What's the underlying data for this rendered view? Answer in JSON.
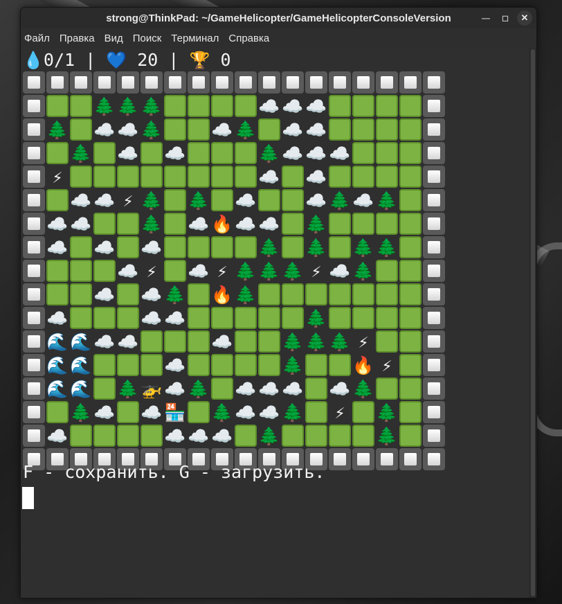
{
  "window": {
    "title": "strong@ThinkPad: ~/GameHelicopter/GameHelicopterConsoleVersion"
  },
  "menu": [
    "Файл",
    "Правка",
    "Вид",
    "Поиск",
    "Терминал",
    "Справка"
  ],
  "status": {
    "water_icon": "💧",
    "water": "0/1",
    "lives_icon": "💙",
    "lives": "20",
    "score_icon": "🏆",
    "score": "0",
    "separator": "|"
  },
  "legend": {
    "W": "wall",
    "G": "field",
    "T": "🌲",
    "C": "☁️",
    "L": "⚡",
    "F": "🔥",
    "R": "🌊",
    "H": "🚁",
    "S": "🏪"
  },
  "map": [
    "WWWWWWWWWWWWWWWWWW",
    "WGGTTTGGGGCCCGGGGW",
    "WTGCCTGGCTGCCGGGGW",
    "WGTGCGCGGGTCCCGGGW",
    "WLGGGGGGGGCGCGGGGW",
    "WGCCLTGTGCGGCTCTGW",
    "WCCGGTGCFCCGTGGGGW",
    "WCGCGCGGGGTGTGTTGW",
    "WGGGCLGCLTTTLCTGGW",
    "WGGCGCTGFTGGGGGGGW",
    "WCGGGCCGGGGGTGGGGW",
    "WRRCCGGGCGGTTTLGGW",
    "WRRGGGCGGGGTGGFLGW",
    "WRRGTHCTGCCCGCTGGW",
    "WGTCGCSGTCCTGLGTGW",
    "WCGGGGCCCGTGGGGTGW",
    "WWWWWWWWWWWWWWWWWW"
  ],
  "prompt": "F - сохранить. G - загрузить."
}
